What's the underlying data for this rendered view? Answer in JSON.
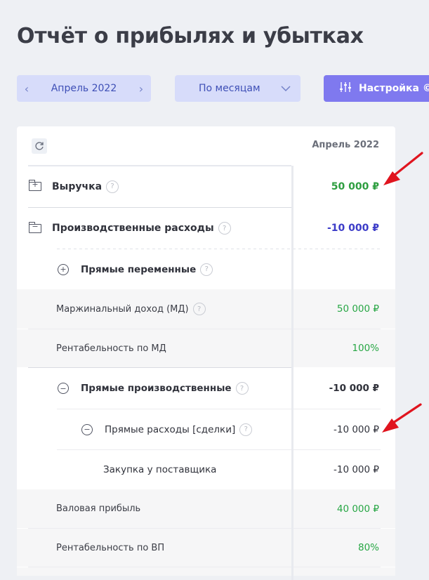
{
  "title": "Отчёт о прибылях и убытках",
  "toolbar": {
    "period_prev": "‹",
    "period_label": "Апрель 2022",
    "period_next": "›",
    "mode_label": "По месяцам",
    "mode_chevron": "⌄",
    "settings_label": "Настройка ©",
    "settings_icon": "sliders-icon"
  },
  "table": {
    "column_header": "Апрель 2022",
    "rows": [
      {
        "label": "Выручка",
        "value": "50 000 ₽"
      },
      {
        "label": "Производственные расходы",
        "value": "-10 000 ₽"
      },
      {
        "label": "Прямые переменные",
        "value": ""
      },
      {
        "label": "Маржинальный доход (МД)",
        "value": "50 000 ₽"
      },
      {
        "label": "Рентабельность по МД",
        "value": "100%"
      },
      {
        "label": "Прямые производственные",
        "value": "-10 000 ₽"
      },
      {
        "label": "Прямые расходы [сделки]",
        "value": "-10 000 ₽"
      },
      {
        "label": "Закупка у поставщика",
        "value": "-10 000 ₽"
      },
      {
        "label": "Валовая прибыль",
        "value": "40 000 ₽"
      },
      {
        "label": "Рентабельность по ВП",
        "value": "80%"
      }
    ]
  },
  "colors": {
    "accent": "#7f79ef",
    "positive": "#28a745",
    "negative_total": "#3c3cc8",
    "annotation": "#e0141e"
  }
}
